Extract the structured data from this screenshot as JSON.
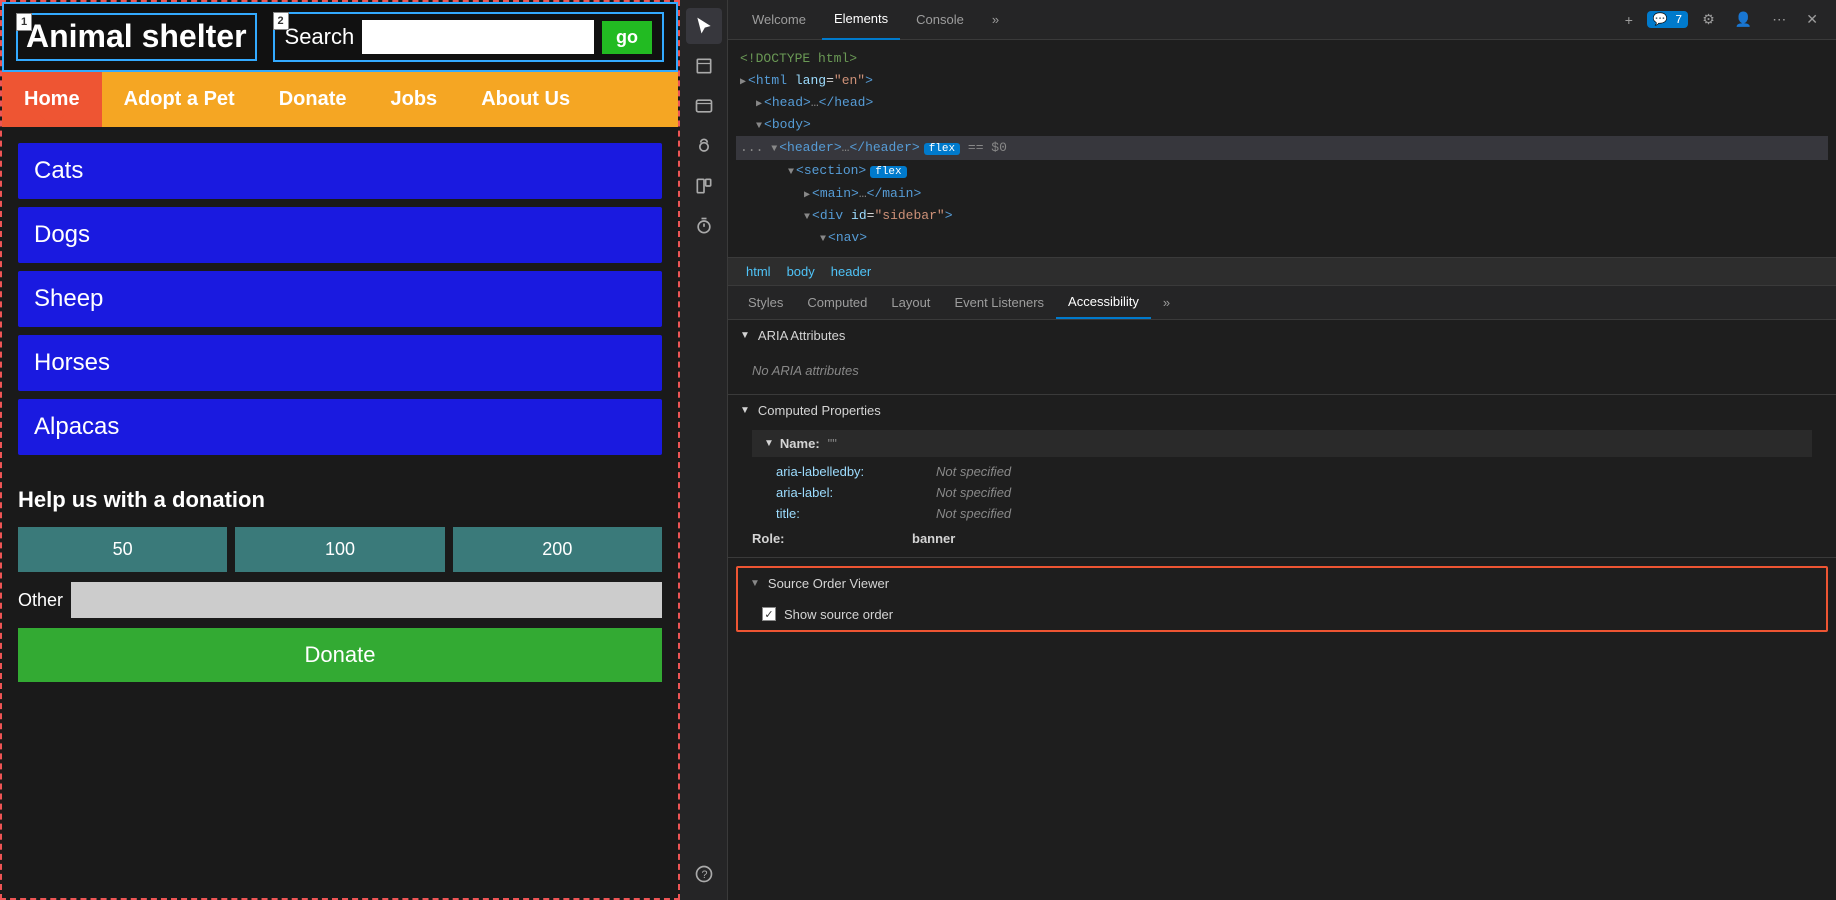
{
  "left": {
    "logo": "Animal shelter",
    "logo_badge1": "1",
    "search_badge2": "2",
    "search_label": "Search",
    "go_button": "go",
    "nav": {
      "items": [
        {
          "label": "Home",
          "active": true
        },
        {
          "label": "Adopt a Pet",
          "active": false
        },
        {
          "label": "Donate",
          "active": false
        },
        {
          "label": "Jobs",
          "active": false
        },
        {
          "label": "About Us",
          "active": false
        }
      ]
    },
    "animals": [
      "Cats",
      "Dogs",
      "Sheep",
      "Horses",
      "Alpacas"
    ],
    "donation": {
      "title": "Help us with a donation",
      "amounts": [
        "50",
        "100",
        "200"
      ],
      "other_label": "Other",
      "donate_button": "Donate"
    }
  },
  "devtools": {
    "tabs": [
      "Welcome",
      "Elements",
      "Console"
    ],
    "active_tab": "Elements",
    "more_label": "»",
    "add_label": "+",
    "comment_count": "7",
    "dom": {
      "lines": [
        {
          "indent": 0,
          "content": "<!DOCTYPE html>",
          "type": "comment"
        },
        {
          "indent": 0,
          "content": "<html lang=\"en\">",
          "type": "tag"
        },
        {
          "indent": 1,
          "content": "▶ <head>…</head>",
          "type": "tag"
        },
        {
          "indent": 1,
          "content": "▼ <body>",
          "type": "tag"
        },
        {
          "indent": 2,
          "content": "▼ <header>…</header>",
          "type": "selected",
          "badge": "flex",
          "special": "== $0"
        },
        {
          "indent": 3,
          "content": "▼ <section>",
          "type": "tag",
          "badge": "flex"
        },
        {
          "indent": 4,
          "content": "▶ <main>…</main>",
          "type": "tag"
        },
        {
          "indent": 4,
          "content": "▼ <div id=\"sidebar\">",
          "type": "tag"
        },
        {
          "indent": 5,
          "content": "▼ <nav>",
          "type": "tag"
        }
      ]
    },
    "breadcrumb": [
      "html",
      "body",
      "header"
    ],
    "panel_tabs": [
      "Styles",
      "Computed",
      "Layout",
      "Event Listeners",
      "Accessibility"
    ],
    "active_panel_tab": "Accessibility",
    "accessibility": {
      "aria_section": "ARIA Attributes",
      "aria_empty": "No ARIA attributes",
      "computed_section": "Computed Properties",
      "name_label": "Name:",
      "name_value": "\"\"",
      "aria_labelledby_key": "aria-labelledby:",
      "aria_labelledby_val": "Not specified",
      "aria_label_key": "aria-label:",
      "aria_label_val": "Not specified",
      "title_key": "title:",
      "title_val": "Not specified",
      "role_key": "Role:",
      "role_val": "banner",
      "source_order_section": "Source Order Viewer",
      "show_source_order_label": "Show source order"
    }
  }
}
